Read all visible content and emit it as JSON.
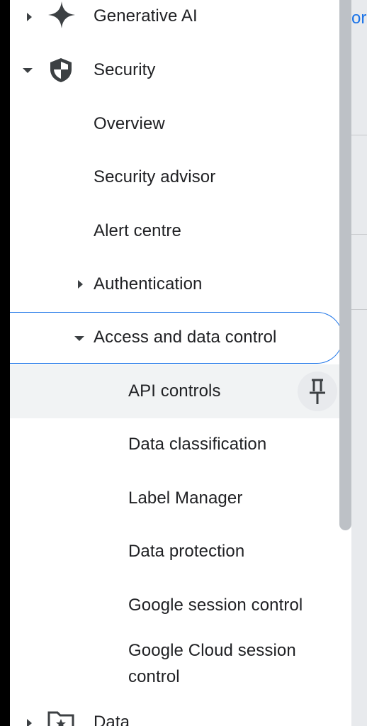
{
  "nav": {
    "generative_ai": "Generative AI",
    "security": "Security",
    "overview": "Overview",
    "security_advisor": "Security advisor",
    "alert_centre": "Alert centre",
    "authentication": "Authentication",
    "access_data_control": "Access and data control",
    "api_controls": "API controls",
    "data_classification": "Data classification",
    "label_manager": "Label Manager",
    "data_protection": "Data protection",
    "google_session_control": "Google session control",
    "google_cloud_session_control_line1": "Google Cloud session",
    "google_cloud_session_control_line2": "control",
    "data": "Data"
  },
  "edge": {
    "partial_text": "ore"
  },
  "icons": {
    "generative_ai": "sparkle-icon",
    "security": "shield-icon",
    "pin": "pin-icon",
    "data": "folder-star-icon"
  },
  "colors": {
    "accent": "#1a73e8",
    "text": "#202124",
    "hover": "#f1f3f4"
  }
}
